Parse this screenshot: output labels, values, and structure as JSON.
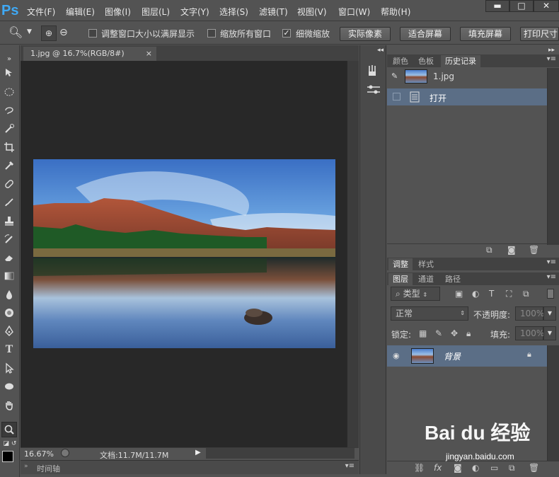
{
  "app": {
    "logo": "Ps"
  },
  "menu": [
    "文件(F)",
    "编辑(E)",
    "图像(I)",
    "图层(L)",
    "文字(Y)",
    "选择(S)",
    "滤镜(T)",
    "视图(V)",
    "窗口(W)",
    "帮助(H)"
  ],
  "window_controls": {
    "minimize": "▬",
    "maximize": "□",
    "close": "✕"
  },
  "options": {
    "resize_windows": "调整窗口大小以满屏显示",
    "zoom_all": "缩放所有窗口",
    "scrubby_zoom": "细微缩放",
    "actual_pixels": "实际像素",
    "fit_screen": "适合屏幕",
    "fill_screen": "填充屏幕",
    "print_size": "打印尺寸"
  },
  "document": {
    "tab_title": "1.jpg @ 16.7%(RGB/8#)",
    "zoom": "16.67%",
    "doc_info": "文档:11.7M/11.7M",
    "timeline": "时间轴"
  },
  "history_panel": {
    "tabs": [
      "颜色",
      "色板",
      "历史记录"
    ],
    "snapshot": "1.jpg",
    "open_step": "打开"
  },
  "adjust_panel": {
    "tabs": [
      "调整",
      "样式"
    ]
  },
  "layers_panel": {
    "tabs": [
      "图层",
      "通道",
      "路径"
    ],
    "filter_type": "类型",
    "blend_mode": "正常",
    "opacity_label": "不透明度:",
    "opacity_value": "100%",
    "lock_label": "锁定:",
    "fill_label": "填充:",
    "fill_value": "100%",
    "layer_name": "背景"
  },
  "watermark": {
    "brand": "Bai du 经验",
    "url": "jingyan.baidu.com"
  },
  "colors": {
    "accent": "#3fa9f5",
    "selected_row": "#5b6e86",
    "canvas_bg": "#282828"
  }
}
